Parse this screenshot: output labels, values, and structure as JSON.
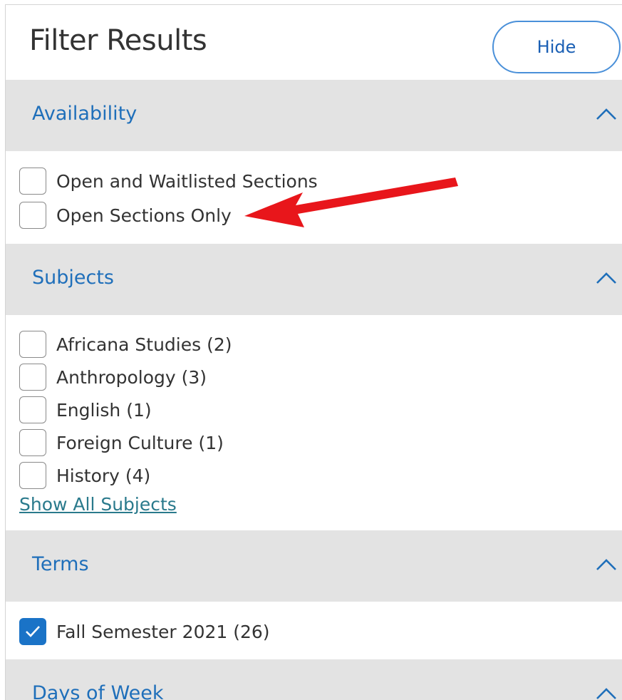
{
  "header": {
    "title": "Filter Results",
    "hide_label": "Hide"
  },
  "sections": {
    "availability": {
      "title": "Availability",
      "options": [
        {
          "label": "Open and Waitlisted Sections",
          "checked": false
        },
        {
          "label": "Open Sections Only",
          "checked": false
        }
      ]
    },
    "subjects": {
      "title": "Subjects",
      "options": [
        {
          "label": "Africana Studies (2)",
          "checked": false
        },
        {
          "label": "Anthropology (3)",
          "checked": false
        },
        {
          "label": "English (1)",
          "checked": false
        },
        {
          "label": "Foreign Culture (1)",
          "checked": false
        },
        {
          "label": "History (4)",
          "checked": false
        }
      ],
      "show_all": "Show All Subjects"
    },
    "terms": {
      "title": "Terms",
      "options": [
        {
          "label": "Fall Semester 2021 (26)",
          "checked": true
        }
      ]
    },
    "days": {
      "title": "Days of Week"
    }
  },
  "icons": {
    "chevron": "chevron-up-icon",
    "check": "checkmark-icon",
    "annotation": "red-arrow-annotation"
  },
  "colors": {
    "accent": "#1f6fba",
    "section_bg": "#e3e3e3",
    "checked_bg": "#1a73c7",
    "annotation": "#e8161b"
  }
}
